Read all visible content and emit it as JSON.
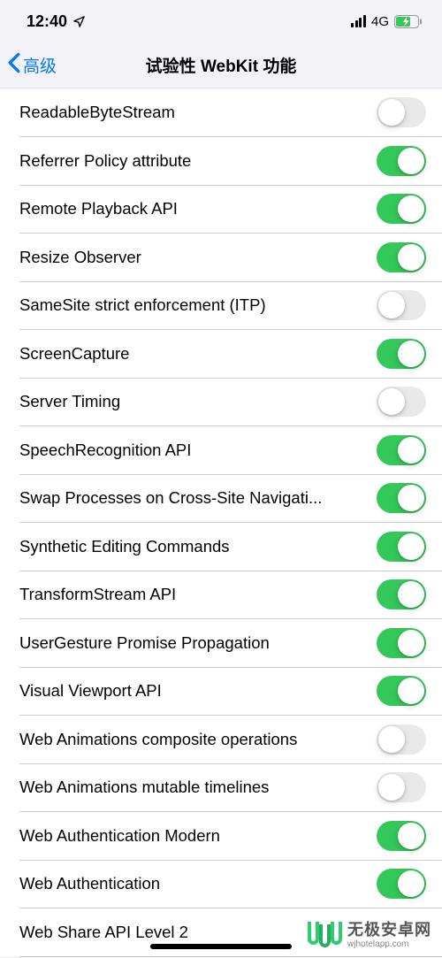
{
  "status_bar": {
    "time": "12:40",
    "network": "4G"
  },
  "nav": {
    "back_label": "高级",
    "title": "试验性 WebKit 功能"
  },
  "settings": [
    {
      "label": "ReadableByteStream",
      "enabled": false
    },
    {
      "label": "Referrer Policy attribute",
      "enabled": true
    },
    {
      "label": "Remote Playback API",
      "enabled": true
    },
    {
      "label": "Resize Observer",
      "enabled": true
    },
    {
      "label": "SameSite strict enforcement (ITP)",
      "enabled": false
    },
    {
      "label": "ScreenCapture",
      "enabled": true
    },
    {
      "label": "Server Timing",
      "enabled": false
    },
    {
      "label": "SpeechRecognition API",
      "enabled": true
    },
    {
      "label": "Swap Processes on Cross-Site Navigati...",
      "enabled": true
    },
    {
      "label": "Synthetic Editing Commands",
      "enabled": true
    },
    {
      "label": "TransformStream API",
      "enabled": true
    },
    {
      "label": "UserGesture Promise Propagation",
      "enabled": true
    },
    {
      "label": "Visual Viewport API",
      "enabled": true
    },
    {
      "label": "Web Animations composite operations",
      "enabled": false
    },
    {
      "label": "Web Animations mutable timelines",
      "enabled": false
    },
    {
      "label": "Web Authentication Modern",
      "enabled": true
    },
    {
      "label": "Web Authentication",
      "enabled": true
    },
    {
      "label": "Web Share API Level 2",
      "enabled": null
    }
  ],
  "watermark": {
    "name": "无极安卓网",
    "url": "wjhotelapp.com"
  }
}
